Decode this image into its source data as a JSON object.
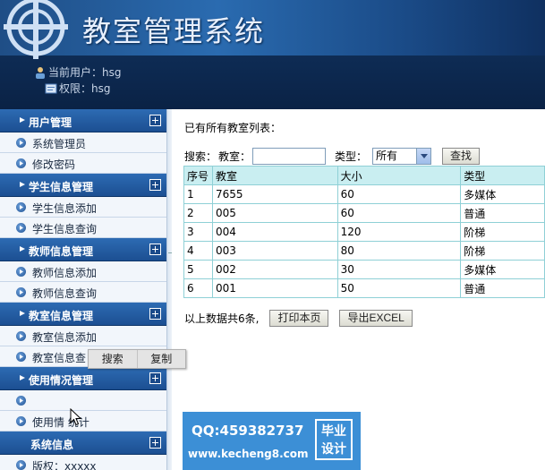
{
  "header": {
    "title": "教室管理系统",
    "current_user": "当前用户：hsg",
    "permission": "权限：hsg"
  },
  "sidebar": {
    "groups": [
      {
        "label": "用户管理",
        "items": [
          "系统管理员",
          "修改密码"
        ]
      },
      {
        "label": "学生信息管理",
        "items": [
          "学生信息添加",
          "学生信息查询"
        ]
      },
      {
        "label": "教师信息管理",
        "items": [
          "教师信息添加",
          "教师信息查询"
        ]
      },
      {
        "label": "教室信息管理",
        "items": [
          "教室信息添加",
          "教室信息查"
        ]
      },
      {
        "label": "使用情况管理",
        "items": [
          "",
          "使用情  统计"
        ]
      },
      {
        "label": "系统信息",
        "items": [
          "版权：xxxxx"
        ]
      }
    ]
  },
  "main": {
    "list_title": "已有所有教室列表：",
    "search": {
      "prefix": "搜索：",
      "room_label": "教室：",
      "room_value": "",
      "type_label": "类型：",
      "type_selected": "所有",
      "button": "查找"
    },
    "table": {
      "headers": [
        "序号",
        "教室",
        "大小",
        "类型"
      ],
      "rows": [
        [
          "1",
          "7655",
          "60",
          "多媒体"
        ],
        [
          "2",
          "005",
          "60",
          "普通"
        ],
        [
          "3",
          "004",
          "120",
          "阶梯"
        ],
        [
          "4",
          "003",
          "80",
          "阶梯"
        ],
        [
          "5",
          "002",
          "30",
          "多媒体"
        ],
        [
          "6",
          "001",
          "50",
          "普通"
        ]
      ]
    },
    "footer": {
      "count_text": "以上数据共6条,",
      "print_button": "打印本页",
      "export_button": "导出EXCEL"
    }
  },
  "context_menu": {
    "items": [
      "搜索",
      "复制"
    ]
  },
  "watermark": {
    "qq": "QQ:459382737",
    "site": "www.kecheng8.com",
    "badge_line1": "毕业",
    "badge_line2": "设计"
  },
  "colors": {
    "header_dark": "#0d2a52",
    "group_head": "#1c4f92",
    "table_header": "#c9eef1",
    "table_border": "#8fd0d6",
    "watermark": "#3c8fd6"
  }
}
